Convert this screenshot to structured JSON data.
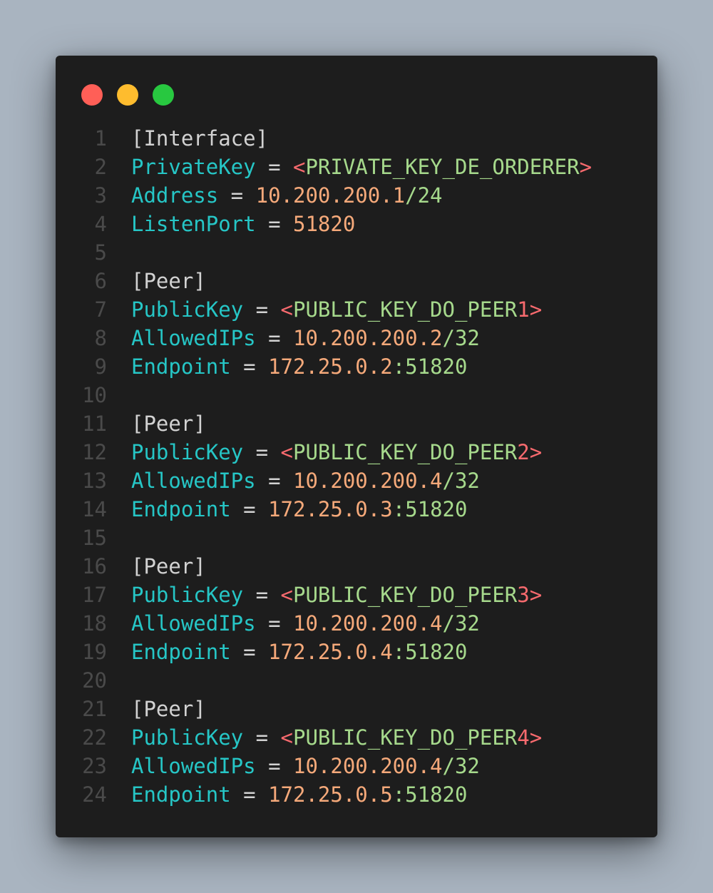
{
  "window": {
    "traffic_lights": [
      {
        "name": "close",
        "color": "#ff5f57"
      },
      {
        "name": "minimize",
        "color": "#febc2e"
      },
      {
        "name": "zoom",
        "color": "#28c840"
      }
    ]
  },
  "lines": [
    {
      "n": "1",
      "tokens": [
        {
          "t": "section",
          "v": "[Interface]"
        }
      ]
    },
    {
      "n": "2",
      "tokens": [
        {
          "t": "key",
          "v": "PrivateKey"
        },
        {
          "t": "eq",
          "v": " = "
        },
        {
          "t": "sym",
          "v": "<"
        },
        {
          "t": "ident",
          "v": "PRIVATE_KEY_DE_ORDERER"
        },
        {
          "t": "sym",
          "v": ">"
        }
      ]
    },
    {
      "n": "3",
      "tokens": [
        {
          "t": "key",
          "v": "Address"
        },
        {
          "t": "eq",
          "v": " = "
        },
        {
          "t": "num",
          "v": "10.200.200.1"
        },
        {
          "t": "ident",
          "v": "/24"
        }
      ]
    },
    {
      "n": "4",
      "tokens": [
        {
          "t": "key",
          "v": "ListenPort"
        },
        {
          "t": "eq",
          "v": " = "
        },
        {
          "t": "num",
          "v": "51820"
        }
      ]
    },
    {
      "n": "5",
      "tokens": []
    },
    {
      "n": "6",
      "tokens": [
        {
          "t": "section",
          "v": "[Peer]"
        }
      ]
    },
    {
      "n": "7",
      "tokens": [
        {
          "t": "key",
          "v": "PublicKey"
        },
        {
          "t": "eq",
          "v": " = "
        },
        {
          "t": "sym",
          "v": "<"
        },
        {
          "t": "ident",
          "v": "PUBLIC_KEY_DO_PEER"
        },
        {
          "t": "sym",
          "v": "1>"
        }
      ]
    },
    {
      "n": "8",
      "tokens": [
        {
          "t": "key",
          "v": "AllowedIPs"
        },
        {
          "t": "eq",
          "v": " = "
        },
        {
          "t": "num",
          "v": "10.200.200.2"
        },
        {
          "t": "ident",
          "v": "/32"
        }
      ]
    },
    {
      "n": "9",
      "tokens": [
        {
          "t": "key",
          "v": "Endpoint"
        },
        {
          "t": "eq",
          "v": " = "
        },
        {
          "t": "num",
          "v": "172.25.0.2"
        },
        {
          "t": "ident",
          "v": ":51820"
        }
      ]
    },
    {
      "n": "10",
      "tokens": []
    },
    {
      "n": "11",
      "tokens": [
        {
          "t": "section",
          "v": "[Peer]"
        }
      ]
    },
    {
      "n": "12",
      "tokens": [
        {
          "t": "key",
          "v": "PublicKey"
        },
        {
          "t": "eq",
          "v": " = "
        },
        {
          "t": "sym",
          "v": "<"
        },
        {
          "t": "ident",
          "v": "PUBLIC_KEY_DO_PEER"
        },
        {
          "t": "sym",
          "v": "2>"
        }
      ]
    },
    {
      "n": "13",
      "tokens": [
        {
          "t": "key",
          "v": "AllowedIPs"
        },
        {
          "t": "eq",
          "v": " = "
        },
        {
          "t": "num",
          "v": "10.200.200.4"
        },
        {
          "t": "ident",
          "v": "/32"
        }
      ]
    },
    {
      "n": "14",
      "tokens": [
        {
          "t": "key",
          "v": "Endpoint"
        },
        {
          "t": "eq",
          "v": " = "
        },
        {
          "t": "num",
          "v": "172.25.0.3"
        },
        {
          "t": "ident",
          "v": ":51820"
        }
      ]
    },
    {
      "n": "15",
      "tokens": []
    },
    {
      "n": "16",
      "tokens": [
        {
          "t": "section",
          "v": "[Peer]"
        }
      ]
    },
    {
      "n": "17",
      "tokens": [
        {
          "t": "key",
          "v": "PublicKey"
        },
        {
          "t": "eq",
          "v": " = "
        },
        {
          "t": "sym",
          "v": "<"
        },
        {
          "t": "ident",
          "v": "PUBLIC_KEY_DO_PEER"
        },
        {
          "t": "sym",
          "v": "3>"
        }
      ]
    },
    {
      "n": "18",
      "tokens": [
        {
          "t": "key",
          "v": "AllowedIPs"
        },
        {
          "t": "eq",
          "v": " = "
        },
        {
          "t": "num",
          "v": "10.200.200.4"
        },
        {
          "t": "ident",
          "v": "/32"
        }
      ]
    },
    {
      "n": "19",
      "tokens": [
        {
          "t": "key",
          "v": "Endpoint"
        },
        {
          "t": "eq",
          "v": " = "
        },
        {
          "t": "num",
          "v": "172.25.0.4"
        },
        {
          "t": "ident",
          "v": ":51820"
        }
      ]
    },
    {
      "n": "20",
      "tokens": []
    },
    {
      "n": "21",
      "tokens": [
        {
          "t": "section",
          "v": "[Peer]"
        }
      ]
    },
    {
      "n": "22",
      "tokens": [
        {
          "t": "key",
          "v": "PublicKey"
        },
        {
          "t": "eq",
          "v": " = "
        },
        {
          "t": "sym",
          "v": "<"
        },
        {
          "t": "ident",
          "v": "PUBLIC_KEY_DO_PEER"
        },
        {
          "t": "sym",
          "v": "4>"
        }
      ]
    },
    {
      "n": "23",
      "tokens": [
        {
          "t": "key",
          "v": "AllowedIPs"
        },
        {
          "t": "eq",
          "v": " = "
        },
        {
          "t": "num",
          "v": "10.200.200.4"
        },
        {
          "t": "ident",
          "v": "/32"
        }
      ]
    },
    {
      "n": "24",
      "tokens": [
        {
          "t": "key",
          "v": "Endpoint"
        },
        {
          "t": "eq",
          "v": " = "
        },
        {
          "t": "num",
          "v": "172.25.0.5"
        },
        {
          "t": "ident",
          "v": ":51820"
        }
      ]
    }
  ]
}
